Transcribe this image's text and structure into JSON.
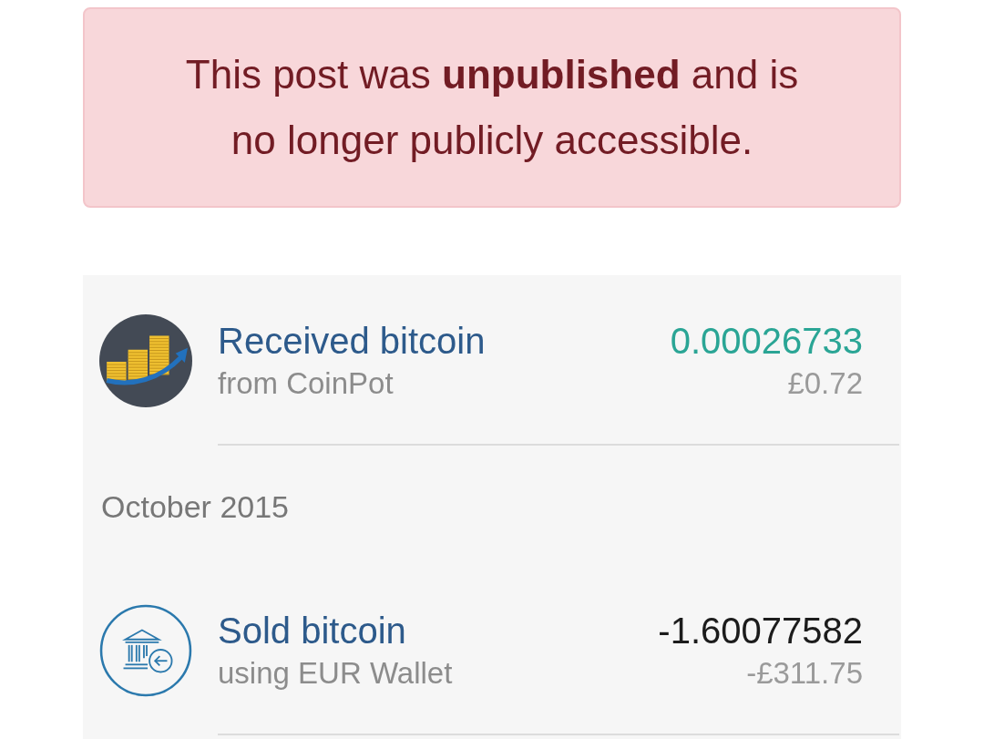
{
  "notice": {
    "text": "This post was **unpublished** and is no longer publicly accessible."
  },
  "transactions": [
    {
      "kind": "received",
      "title": "Received bitcoin",
      "subtitle": "from CoinPot",
      "amount": "0.00026733",
      "fiat": "£0.72"
    },
    {
      "kind": "month",
      "label": "October 2015"
    },
    {
      "kind": "sold",
      "title": "Sold bitcoin",
      "subtitle": "using EUR Wallet",
      "amount": "-1.60077582",
      "fiat": "-£311.75"
    }
  ]
}
